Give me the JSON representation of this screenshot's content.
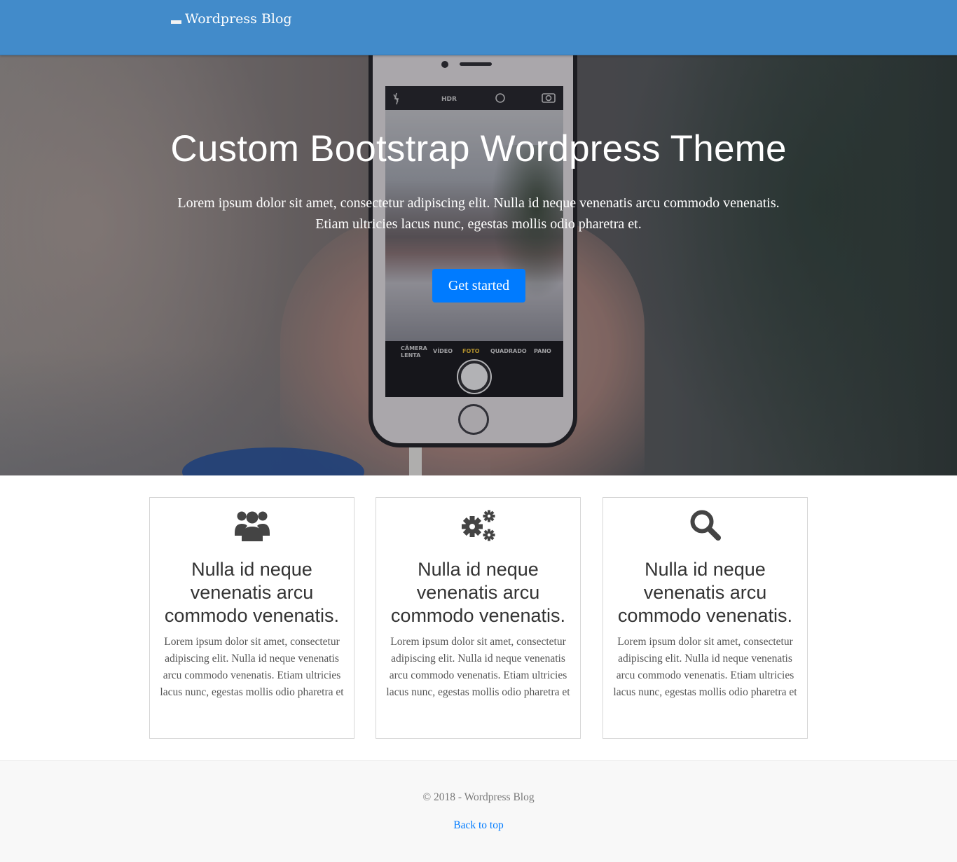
{
  "navbar": {
    "brand": "Wordpress Blog",
    "colors": {
      "background": "#428bca",
      "text": "#ffffff"
    }
  },
  "hero": {
    "title": "Custom Bootstrap Wordpress Theme",
    "lead": "Lorem ipsum dolor sit amet, consectetur adipiscing elit. Nulla id neque venenatis arcu commodo venenatis. Etiam ultricies lacus nunc, egestas mollis odio pharetra et.",
    "button_label": "Get started",
    "button_color": "#007bff",
    "phone_modes": [
      "CÂMERA LENTA",
      "VÍDEO",
      "FOTO",
      "QUADRADO",
      "PANO"
    ]
  },
  "features": [
    {
      "icon": "users-icon",
      "title": "Nulla id neque venenatis arcu commodo venenatis.",
      "text": "Lorem ipsum dolor sit amet, consectetur adipiscing elit. Nulla id neque venenatis arcu commodo venenatis. Etiam ultricies lacus nunc, egestas mollis odio pharetra et"
    },
    {
      "icon": "gears-icon",
      "title": "Nulla id neque venenatis arcu commodo venenatis.",
      "text": "Lorem ipsum dolor sit amet, consectetur adipiscing elit. Nulla id neque venenatis arcu commodo venenatis. Etiam ultricies lacus nunc, egestas mollis odio pharetra et"
    },
    {
      "icon": "search-icon",
      "title": "Nulla id neque venenatis arcu commodo venenatis.",
      "text": "Lorem ipsum dolor sit amet, consectetur adipiscing elit. Nulla id neque venenatis arcu commodo venenatis. Etiam ultricies lacus nunc, egestas mollis odio pharetra et"
    }
  ],
  "footer": {
    "copyright": "© 2018 - Wordpress Blog",
    "back_to_top": "Back to top",
    "link_color": "#007bff"
  }
}
